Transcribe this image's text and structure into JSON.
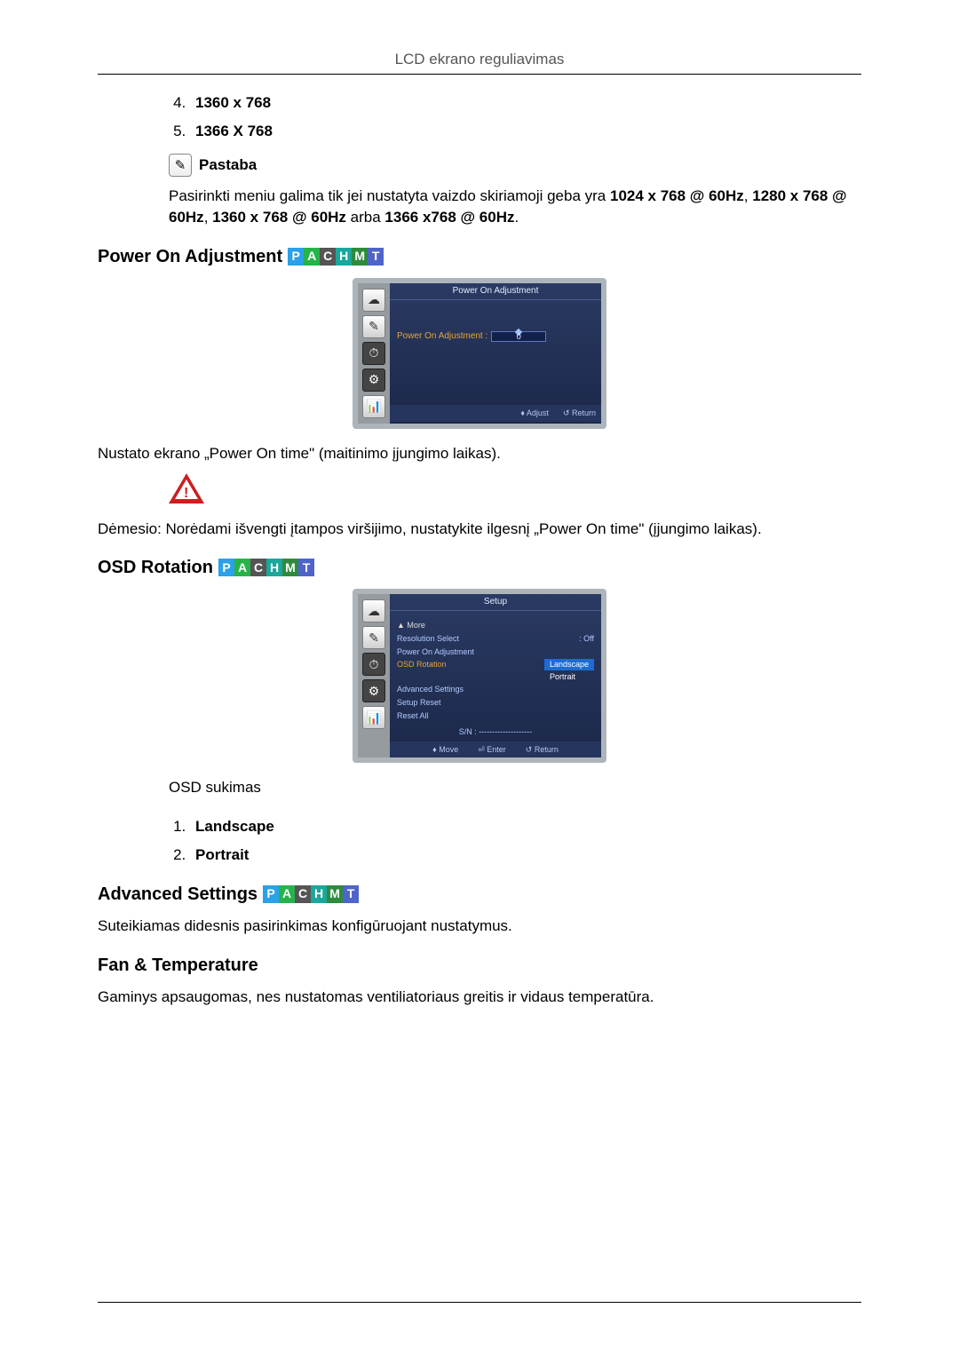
{
  "header": {
    "title": "LCD ekrano reguliavimas"
  },
  "resolutions": {
    "start_index": 4,
    "items": [
      "1360 x 768",
      "1366 X 768"
    ]
  },
  "note": {
    "label": "Pastaba",
    "text_parts": {
      "a": "Pasirinkti meniu galima tik jei nustatyta vaizdo skiriamoji geba yra ",
      "b": "1024 x 768 @ 60Hz",
      "c": ", ",
      "d": "1280 x 768 @ 60Hz",
      "e": ", ",
      "f": "1360 x 768 @ 60Hz",
      "g": " arba ",
      "h": "1366 x768 @ 60Hz",
      "i": "."
    }
  },
  "badges": [
    "P",
    "A",
    "C",
    "H",
    "M",
    "T"
  ],
  "power_on": {
    "heading": "Power On Adjustment",
    "osd": {
      "title": "Power On Adjustment",
      "row_label": "Power On Adjustment :",
      "value": "0",
      "footer_adjust": "♦ Adjust",
      "footer_return": "↺ Return"
    },
    "desc": "Nustato ekrano „Power On time\" (maitinimo įjungimo laikas).",
    "warn": "Dėmesio: Norėdami išvengti įtampos viršijimo, nustatykite ilgesnį „Power On time\" (įjungimo laikas)."
  },
  "osd_rotation": {
    "heading": "OSD Rotation",
    "osd": {
      "title": "Setup",
      "more": "▲ More",
      "items": {
        "res_sel": "Resolution Select",
        "res_val": ": Off",
        "poa": "Power On Adjustment",
        "rot": "OSD Rotation",
        "adv": "Advanced Settings",
        "sreset": "Setup Reset",
        "rall": "Reset All"
      },
      "opt_landscape": "Landscape",
      "opt_portrait": "Portrait",
      "sn_label": "S/N :",
      "sn_val": "--------------------",
      "footer_move": "♦ Move",
      "footer_enter": "⏎ Enter",
      "footer_return": "↺ Return"
    },
    "desc": "OSD sukimas",
    "options": [
      "Landscape",
      "Portrait"
    ]
  },
  "adv": {
    "heading": "Advanced Settings",
    "desc": "Suteikiamas didesnis pasirinkimas konfigūruojant nustatymus."
  },
  "fan": {
    "heading": "Fan & Temperature",
    "desc": "Gaminys apsaugomas, nes nustatomas ventiliatoriaus greitis ir vidaus temperatūra."
  },
  "icons": {
    "note": "✎",
    "side": [
      "☁",
      "✎",
      "⏱",
      "⚙",
      "📊"
    ]
  }
}
